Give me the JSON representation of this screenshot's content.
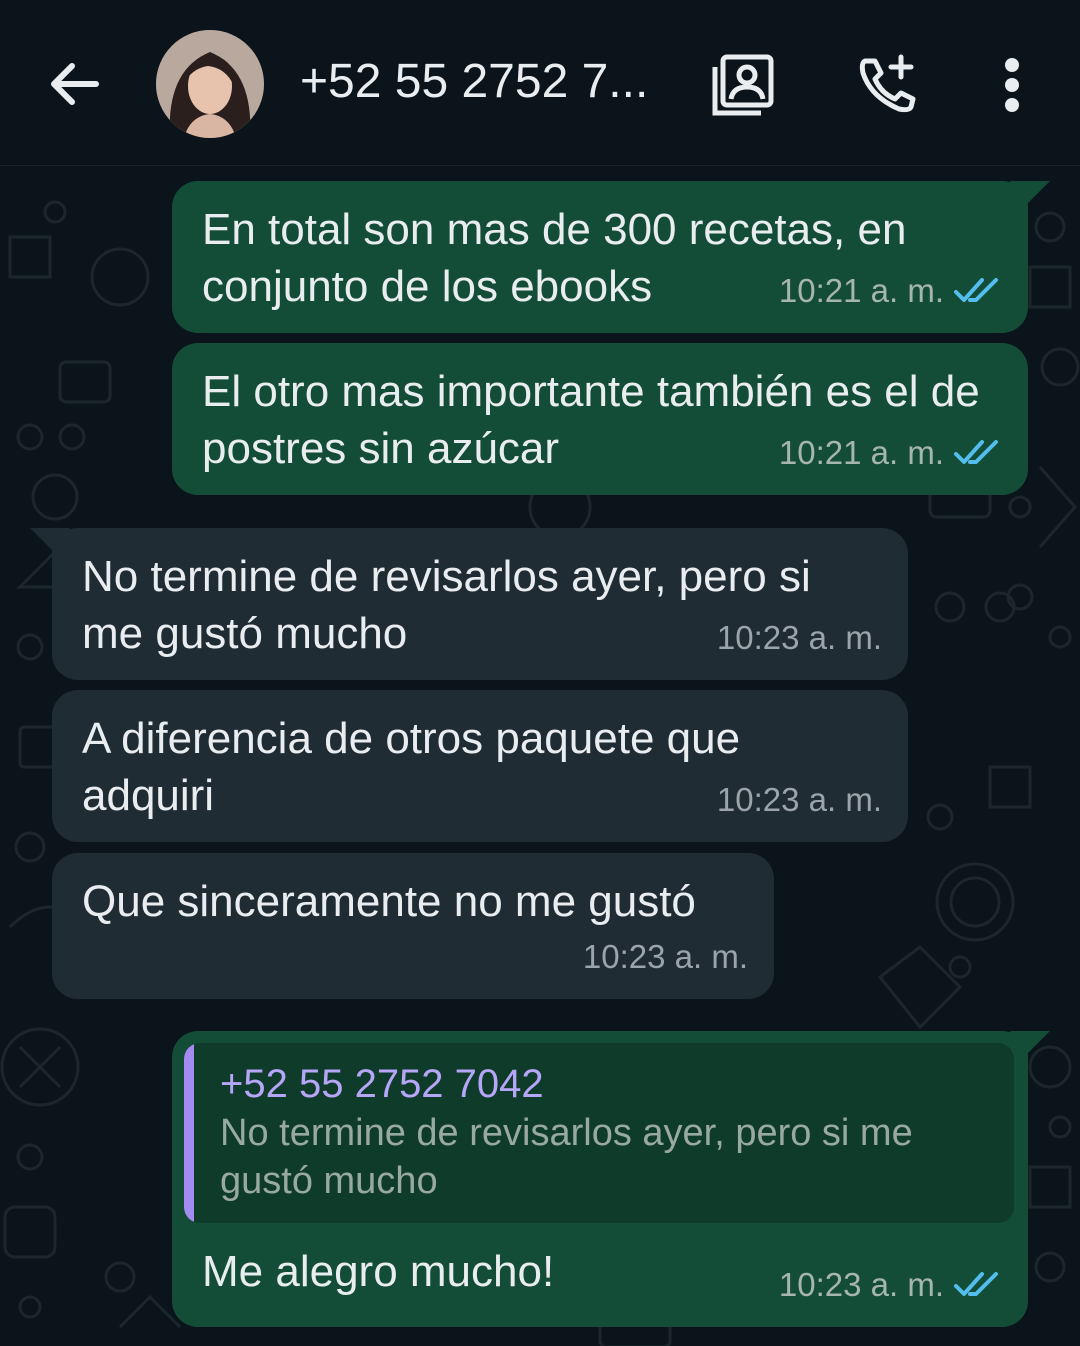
{
  "header": {
    "contact_name": "+52 55 2752 7...",
    "icons": {
      "back": "arrow-left-icon",
      "contact_card": "contact-card-icon",
      "add_call": "add-call-icon",
      "menu": "more-vert-icon"
    }
  },
  "messages": [
    {
      "direction": "out",
      "text": "En total son mas de 300 recetas, en conjunto de los ebooks",
      "time": "10:21 a. m.",
      "status": "read"
    },
    {
      "direction": "out",
      "text": "El otro mas importante también es el de postres sin azúcar",
      "time": "10:21 a. m.",
      "status": "read"
    },
    {
      "direction": "in",
      "text": "No termine de revisarlos ayer, pero si me gustó mucho",
      "time": "10:23 a. m."
    },
    {
      "direction": "in",
      "text": "A diferencia de otros paquete que adquiri",
      "time": "10:23 a. m."
    },
    {
      "direction": "in",
      "text": "Que sinceramente no me gustó",
      "time": "10:23 a. m."
    },
    {
      "direction": "out",
      "quote": {
        "author": "+52 55 2752 7042",
        "text": "No termine de revisarlos ayer, pero si me gustó mucho"
      },
      "text": "Me alegro mucho!",
      "time": "10:23 a. m.",
      "status": "read"
    }
  ],
  "colors": {
    "background": "#0b141a",
    "outgoing_bubble": "#144d37",
    "incoming_bubble": "#202c33",
    "read_ticks": "#53bdeb",
    "quote_accent": "#a38bf0"
  }
}
